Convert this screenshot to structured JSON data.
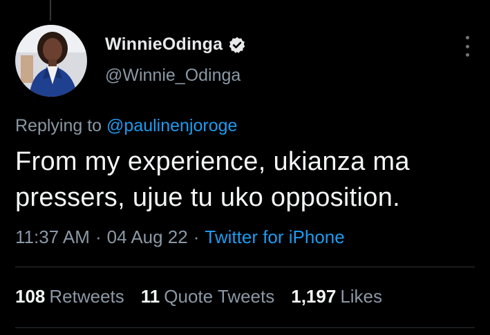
{
  "author": {
    "display_name": "WinnieOdinga",
    "handle": "@Winnie_Odinga",
    "verified": true,
    "avatar_icon": "profile-photo"
  },
  "reply": {
    "prefix": "Replying to",
    "mention": "@paulinenjoroge"
  },
  "tweet": {
    "text": "From my experience, ukianza ma pressers, ujue tu uko opposition.",
    "time": "11:37 AM",
    "date": "04 Aug 22",
    "source": "Twitter for iPhone",
    "separator": "·"
  },
  "stats": {
    "retweets_count": "108",
    "retweets_label": "Retweets",
    "quotes_count": "11",
    "quotes_label": "Quote Tweets",
    "likes_count": "1,197",
    "likes_label": "Likes"
  },
  "colors": {
    "background": "#000000",
    "accent": "#1d9bf0",
    "secondary_text": "#8b98a5",
    "primary_text": "#e7e9ea"
  }
}
